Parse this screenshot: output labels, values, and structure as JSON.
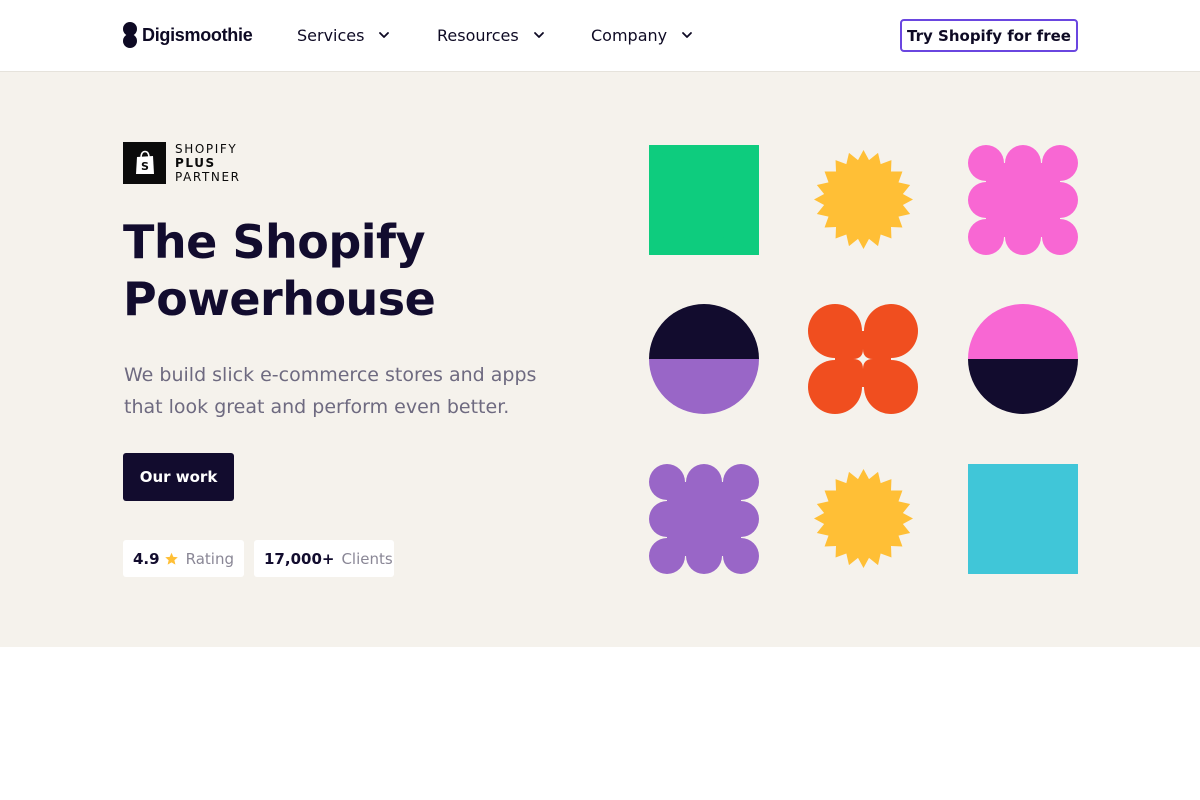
{
  "header": {
    "brand": "Digismoothie",
    "nav": [
      {
        "label": "Services"
      },
      {
        "label": "Resources"
      },
      {
        "label": "Company"
      }
    ],
    "cta_label": "Try Shopify for free",
    "cta_border_color": "#6a46e0"
  },
  "hero": {
    "badge": {
      "line1": "SHOPIFY",
      "line2": "PLUS",
      "line3": "PARTNER"
    },
    "title_line1": "The Shopify",
    "title_line2": "Powerhouse",
    "subtitle": "We build slick e-commerce stores and apps that look great and perform even better.",
    "button_label": "Our work",
    "rating": {
      "value": "4.9",
      "icon": "star-icon",
      "label": "Rating"
    },
    "clients": {
      "value": "17,000+",
      "label": "Clients"
    },
    "background_color": "#f5f2ec"
  },
  "shapes": [
    {
      "name": "green-blob-shape",
      "color": "#0ecc7e"
    },
    {
      "name": "yellow-starburst-shape",
      "color": "#ffbf36"
    },
    {
      "name": "pink-flower-shape",
      "color": "#f867d3"
    },
    {
      "name": "navy-purple-circle-shape",
      "colors": [
        "#120c2e",
        "#9966c7"
      ]
    },
    {
      "name": "orange-clover-shape",
      "color": "#f04e1f"
    },
    {
      "name": "pink-navy-circle-shape",
      "colors": [
        "#f867d3",
        "#120c2e"
      ]
    },
    {
      "name": "purple-flower-shape",
      "color": "#9966c7"
    },
    {
      "name": "yellow-starburst-shape-2",
      "color": "#ffbf36"
    },
    {
      "name": "cyan-blob-shape",
      "color": "#40c6d8"
    }
  ]
}
